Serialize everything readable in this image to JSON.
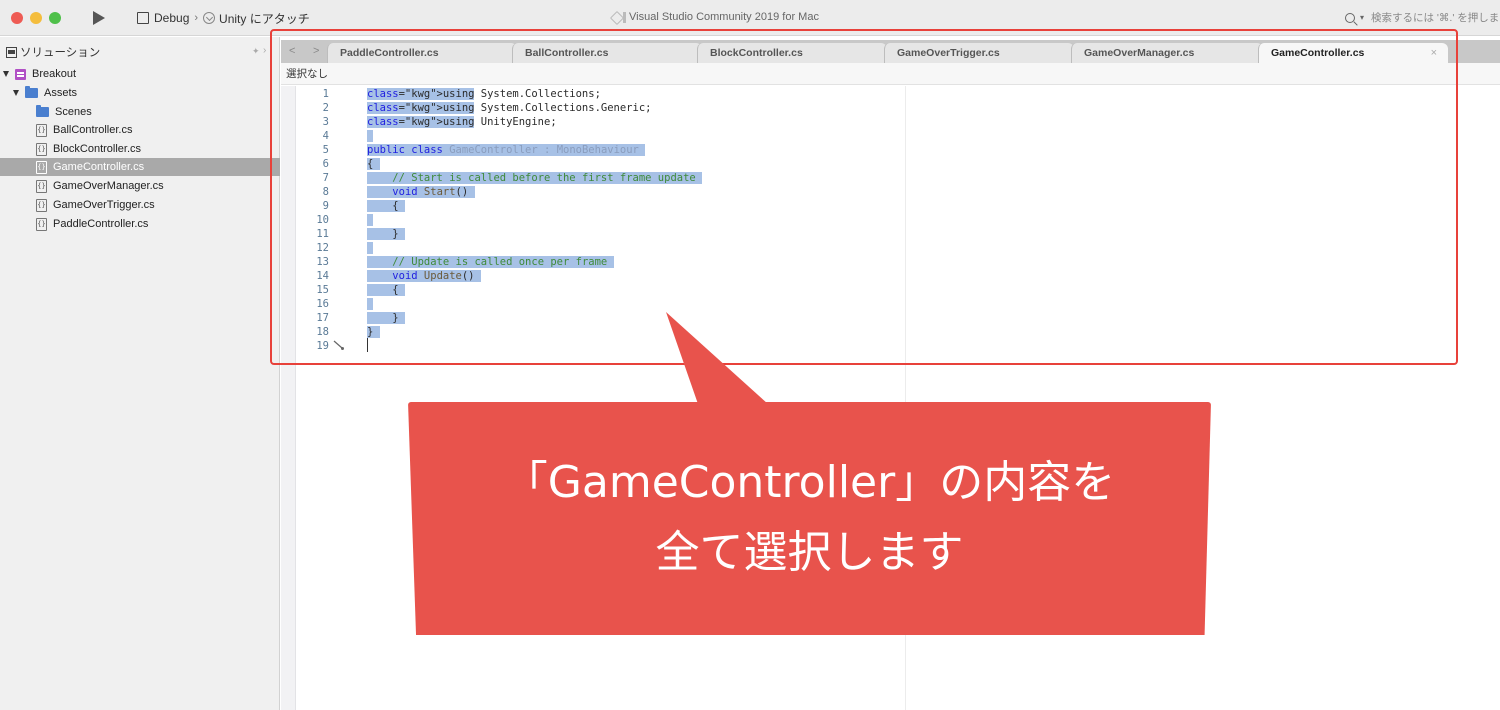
{
  "titlebar": {
    "configuration": "Debug",
    "separator": "›",
    "target": "Unity にアタッチ",
    "app_title": "Visual Studio Community 2019 for Mac",
    "search_placeholder": "検索するには '⌘.' を押しま"
  },
  "sidebar": {
    "title": "ソリューション",
    "pin_glyph": "✦",
    "collapse_glyph": "›",
    "tree": [
      {
        "label": "Breakout",
        "type": "project",
        "depth": 0,
        "expanded": true
      },
      {
        "label": "Assets",
        "type": "folder",
        "depth": 1,
        "expanded": true
      },
      {
        "label": "Scenes",
        "type": "folder",
        "depth": 2
      },
      {
        "label": "BallController.cs",
        "type": "file",
        "depth": 2
      },
      {
        "label": "BlockController.cs",
        "type": "file",
        "depth": 2
      },
      {
        "label": "GameController.cs",
        "type": "file",
        "depth": 2,
        "selected": true
      },
      {
        "label": "GameOverManager.cs",
        "type": "file",
        "depth": 2
      },
      {
        "label": "GameOverTrigger.cs",
        "type": "file",
        "depth": 2
      },
      {
        "label": "PaddleController.cs",
        "type": "file",
        "depth": 2
      }
    ]
  },
  "editor": {
    "nav_back": "<",
    "nav_forward": ">",
    "tabs": [
      {
        "label": "PaddleController.cs",
        "active": false
      },
      {
        "label": "BallController.cs",
        "active": false
      },
      {
        "label": "BlockController.cs",
        "active": false
      },
      {
        "label": "GameOverTrigger.cs",
        "active": false
      },
      {
        "label": "GameOverManager.cs",
        "active": false
      },
      {
        "label": "GameController.cs",
        "active": true
      }
    ],
    "close_glyph": "×",
    "breadcrumb": "選択なし",
    "line_numbers": [
      "1",
      "2",
      "3",
      "4",
      "5",
      "6",
      "7",
      "8",
      "9",
      "10",
      "11",
      "12",
      "13",
      "14",
      "15",
      "16",
      "17",
      "18",
      "19"
    ],
    "code_lines": [
      "using System.Collections;",
      "using System.Collections.Generic;",
      "using UnityEngine;",
      "",
      "public class GameController : MonoBehaviour",
      "{",
      "    // Start is called before the first frame update",
      "    void Start()",
      "    {",
      "",
      "    }",
      "",
      "    // Update is called once per frame",
      "    void Update()",
      "    {",
      "",
      "    }",
      "}",
      ""
    ],
    "selection": "all",
    "caret_line": 19
  },
  "annotation": {
    "callout_line1": "「GameController」の内容を",
    "callout_line2": "全て選択します",
    "color": "#e8534c",
    "highlight_color": "#e8413a"
  }
}
